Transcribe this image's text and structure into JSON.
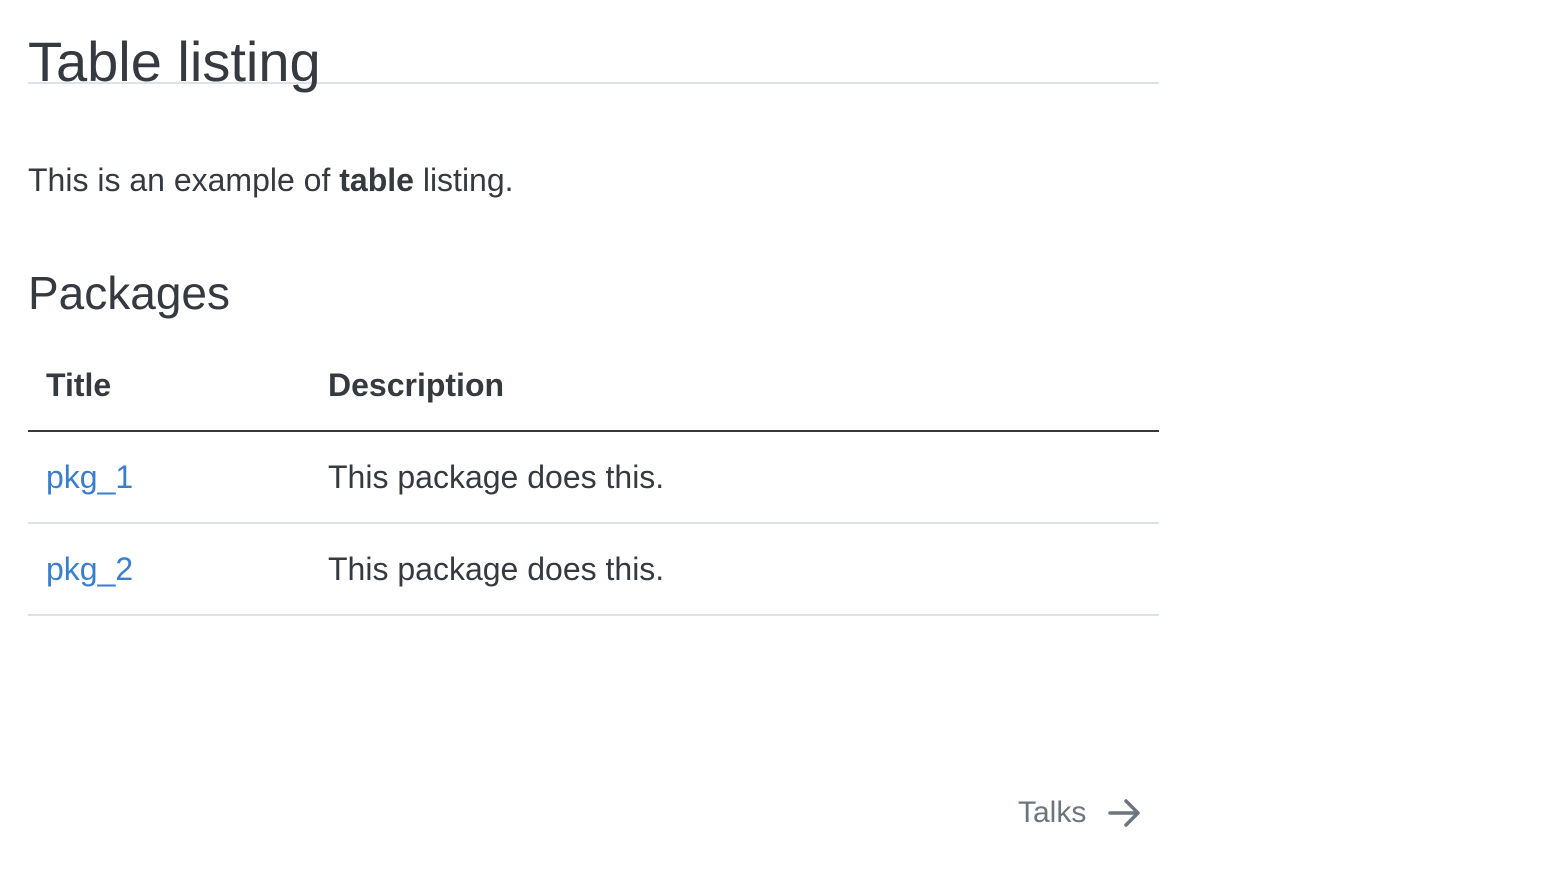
{
  "page": {
    "title": "Table listing",
    "intro": {
      "before": "This is an example of ",
      "bold": "table",
      "after": " listing."
    }
  },
  "section": {
    "heading": "Packages"
  },
  "table": {
    "headers": [
      "Title",
      "Description"
    ],
    "rows": [
      {
        "title": "pkg_1",
        "description": "This package does this."
      },
      {
        "title": "pkg_2",
        "description": "This package does this."
      }
    ]
  },
  "navigation": {
    "next_label": "Talks",
    "next_icon": "arrow-right-icon"
  },
  "colors": {
    "text": "#343a40",
    "link": "#3a7fcf",
    "muted": "#6c757d",
    "rule": "#dee2e6"
  }
}
